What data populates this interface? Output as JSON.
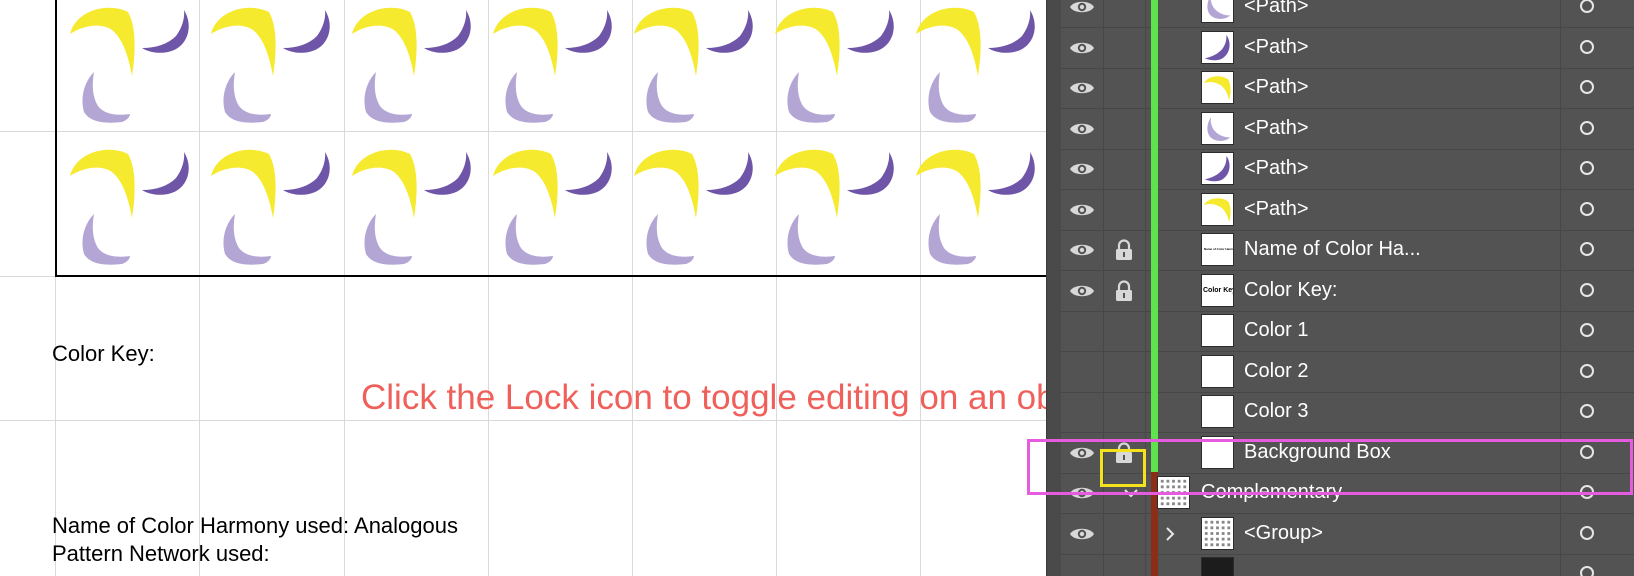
{
  "document": {
    "color_key_label": "Color Key:",
    "harmony_label": "Name of Color Harmony used: Analogous",
    "network_label": "Pattern Network used:"
  },
  "annotation": {
    "text": "Click the Lock icon to toggle editing on an object",
    "color": "#f0605b"
  },
  "highlights": {
    "row_color": "#e55ce0",
    "lock_color": "#f3e21c"
  },
  "pattern_colors": {
    "yellow": "#f6ea2f",
    "dark_purple": "#6f55a8",
    "light_purple": "#b4a6d4"
  },
  "layers_panel": {
    "rows": [
      {
        "label": "<Path>",
        "visible": true,
        "locked": false,
        "thumb": "path-lilac",
        "color_bar": "#5ee34d"
      },
      {
        "label": "<Path>",
        "visible": true,
        "locked": false,
        "thumb": "path-purple",
        "color_bar": "#5ee34d"
      },
      {
        "label": "<Path>",
        "visible": true,
        "locked": false,
        "thumb": "path-yellow",
        "color_bar": "#5ee34d"
      },
      {
        "label": "<Path>",
        "visible": true,
        "locked": false,
        "thumb": "path-lilac",
        "color_bar": "#5ee34d"
      },
      {
        "label": "<Path>",
        "visible": true,
        "locked": false,
        "thumb": "path-purple",
        "color_bar": "#5ee34d"
      },
      {
        "label": "<Path>",
        "visible": true,
        "locked": false,
        "thumb": "path-yellow",
        "color_bar": "#5ee34d"
      },
      {
        "label": "Name of Color Ha...",
        "visible": true,
        "locked": true,
        "thumb": "text-tiny",
        "color_bar": "#5ee34d"
      },
      {
        "label": "Color Key:",
        "visible": true,
        "locked": true,
        "thumb": "text-colorkey",
        "thumb_text": "Color Key:",
        "color_bar": "#5ee34d"
      },
      {
        "label": "Color 1",
        "visible": false,
        "locked": false,
        "thumb": "blank",
        "color_bar": "#5ee34d"
      },
      {
        "label": "Color 2",
        "visible": false,
        "locked": false,
        "thumb": "blank",
        "color_bar": "#5ee34d"
      },
      {
        "label": "Color 3",
        "visible": false,
        "locked": false,
        "thumb": "blank",
        "color_bar": "#5ee34d"
      },
      {
        "label": "Background Box",
        "visible": true,
        "locked": true,
        "thumb": "blank",
        "color_bar": "#5ee34d"
      },
      {
        "label": "Complementary",
        "visible": true,
        "locked": false,
        "thumb": "pattern",
        "color_bar": "#8b2d17",
        "expand": "expanded",
        "level": 0
      },
      {
        "label": "<Group>",
        "visible": true,
        "locked": false,
        "thumb": "pattern",
        "color_bar": "#8b2d17",
        "expand": "collapsed",
        "level": 1
      },
      {
        "label": "",
        "visible": false,
        "locked": false,
        "thumb": "dark",
        "color_bar": "#8b2d17"
      }
    ]
  }
}
